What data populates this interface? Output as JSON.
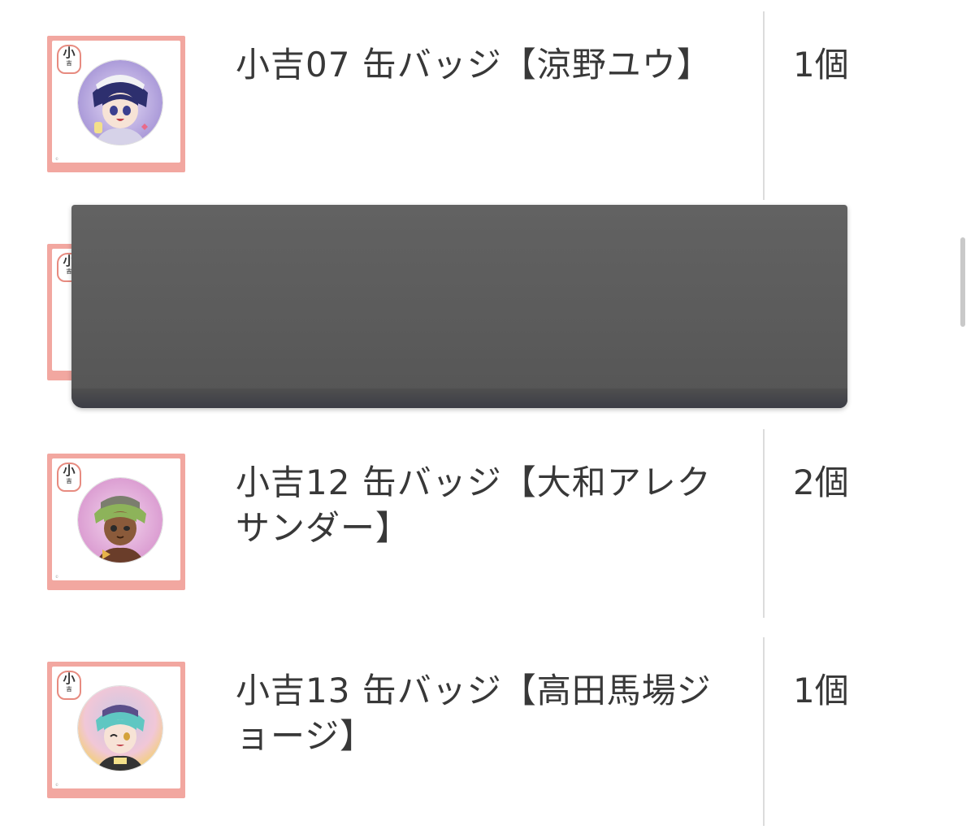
{
  "items": [
    {
      "title": "小吉07 缶バッジ【涼野ユウ】",
      "qty": "1個",
      "badge_label": "小",
      "badge_sub": "吉",
      "image_colors": {
        "bg": "#b7a6dc",
        "hair": "#2d2f6e",
        "accent": "#f3e08a"
      }
    },
    {
      "title": "",
      "qty": "",
      "badge_label": "小",
      "badge_sub": "吉",
      "image_colors": {
        "bg": "#d8d0ea",
        "hair": "#555",
        "accent": "#ddd"
      }
    },
    {
      "title": "小吉12 缶バッジ【大和アレクサンダー】",
      "qty": "2個",
      "badge_label": "小",
      "badge_sub": "吉",
      "image_colors": {
        "bg": "#e2a6d8",
        "hair": "#8db35a",
        "accent": "#6a3d2a"
      }
    },
    {
      "title": "小吉13 缶バッジ【高田馬場ジョージ】",
      "qty": "1個",
      "badge_label": "小",
      "badge_sub": "吉",
      "image_colors": {
        "bg": "#f3cf7d",
        "hair": "#5fc7c2",
        "accent": "#5a4f8a"
      }
    }
  ],
  "colors": {
    "thumb_border": "#f2a7a0",
    "divider": "#dcdcdc",
    "overlay": "#5d5d5d"
  }
}
